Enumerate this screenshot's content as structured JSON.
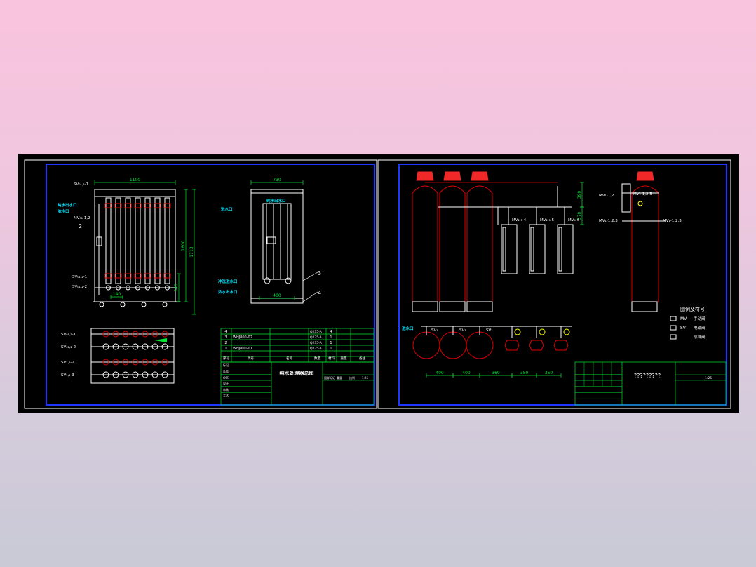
{
  "colors": {
    "canvas": "#000000",
    "frame": "#ffffff",
    "border": "#1f36ff",
    "table": "#00e632",
    "dimension": "#00e632",
    "pipe": "#ffffff",
    "vessel": "#e00000",
    "cyan_label": "#00e6ff",
    "hatch": "#b4b4b4",
    "yellow": "#ffff00",
    "cap": "#f02828"
  },
  "left_sheet": {
    "front_view": {
      "dims": [
        "1100",
        "1600",
        "1713",
        "540",
        "140"
      ],
      "labels": {
        "sv_top": "SV₀₁,₂-1",
        "sv_mid": "SV₀₁,₂-1",
        "sv_mid2": "SV₀₁,₂-2",
        "out1": "纯水出水口",
        "out2": "浓水口",
        "mv": "MV₀₁-1,2",
        "callout": "2"
      }
    },
    "side_view": {
      "dims": [
        "730",
        "400"
      ],
      "labels": {
        "inlet": "进水口",
        "outlet_top": "纯水出水口",
        "flush_in": "冲洗进水口",
        "drain": "浓水出水口",
        "c3": "3",
        "c4": "4"
      }
    },
    "plan_view": {
      "labels": [
        "SV₀₁,₂-1",
        "SV₀₁,₂-2",
        "SV₁,₂-2",
        "SV₁,₂-3"
      ]
    },
    "parts_table": {
      "rows": [
        {
          "no": "4",
          "code": "",
          "name": "",
          "material": "Q235-A",
          "qty": "4",
          "weight": ""
        },
        {
          "no": "3",
          "code": "WHJ800-02",
          "name": "",
          "material": "Q235-A",
          "qty": "1",
          "weight": ""
        },
        {
          "no": "2",
          "code": "",
          "name": "",
          "material": "Q235-A",
          "qty": "1",
          "weight": ""
        },
        {
          "no": "1",
          "code": "WHJ800-01",
          "name": "",
          "material": "Q235-A",
          "qty": "1",
          "weight": ""
        }
      ],
      "header": [
        "序号",
        "代号",
        "名称",
        "数量",
        "材料",
        "重量",
        "备注"
      ],
      "title": "纯水处理器总图",
      "title_cells": [
        "图样标记",
        "重量",
        "比例",
        "1:25"
      ],
      "sign_cells": [
        "标记",
        "处数",
        "分区",
        "设计",
        "审核",
        "工艺",
        "标准化",
        "批准"
      ]
    }
  },
  "right_sheet": {
    "elevation": {
      "labels": [
        "MV₂,₃-4",
        "MV₂,₃-5",
        "MV₄-6"
      ],
      "dims": [
        "390",
        "570"
      ]
    },
    "side_elevation": {
      "labels": [
        "MV₁-1,2",
        "MV₁-1,2,3",
        "MV₁-1,2,3",
        "MV₁-1,2,3"
      ]
    },
    "plan": {
      "labels": {
        "inlet": "进水口",
        "sv1": "SV₁",
        "sv2": "SV₂",
        "sv3": "SV₃"
      },
      "dims": [
        "400",
        "400",
        "360",
        "350",
        "350"
      ]
    },
    "legend": {
      "title": "图例及符号",
      "items": [
        {
          "code": "MV",
          "text": "手动阀"
        },
        {
          "code": "SV",
          "text": "电磁阀"
        },
        {
          "code": "",
          "text": "取样阀"
        }
      ]
    },
    "title_block": {
      "title": "?????????",
      "scale": "1:25"
    }
  }
}
